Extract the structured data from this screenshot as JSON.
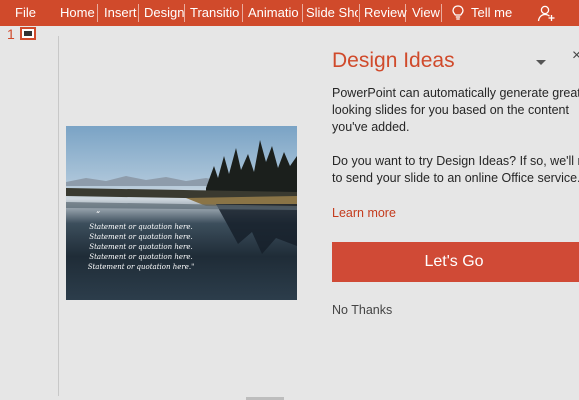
{
  "ribbon": {
    "tabs": [
      {
        "label": "File"
      },
      {
        "label": "Home"
      },
      {
        "label": "Insert"
      },
      {
        "label": "Design"
      },
      {
        "label": "Transitior"
      },
      {
        "label": "Animatio"
      },
      {
        "label": "Slide Sho"
      },
      {
        "label": "Review"
      },
      {
        "label": "View"
      }
    ],
    "tell_me": "Tell me",
    "colors": {
      "accent": "#d04a2b"
    }
  },
  "thumbnails": {
    "slide_number": "1"
  },
  "slide": {
    "lines": [
      "Statement or quotation here.",
      "Statement or quotation here.",
      "Statement or quotation here.",
      "Statement or quotation here.",
      "Statement or quotation here.\""
    ],
    "quote_open": "“"
  },
  "design_pane": {
    "title": "Design Ideas",
    "para1": [
      "PowerPoint can automatically generate great",
      "looking slides for you based on the content",
      "you've added."
    ],
    "para2": [
      "Do you want to try Design Ideas? If so, we'll nee",
      "to send your slide to an online Office service."
    ],
    "learn_more": "Learn more",
    "go_button": "Let's Go",
    "no_thanks": "No Thanks"
  }
}
